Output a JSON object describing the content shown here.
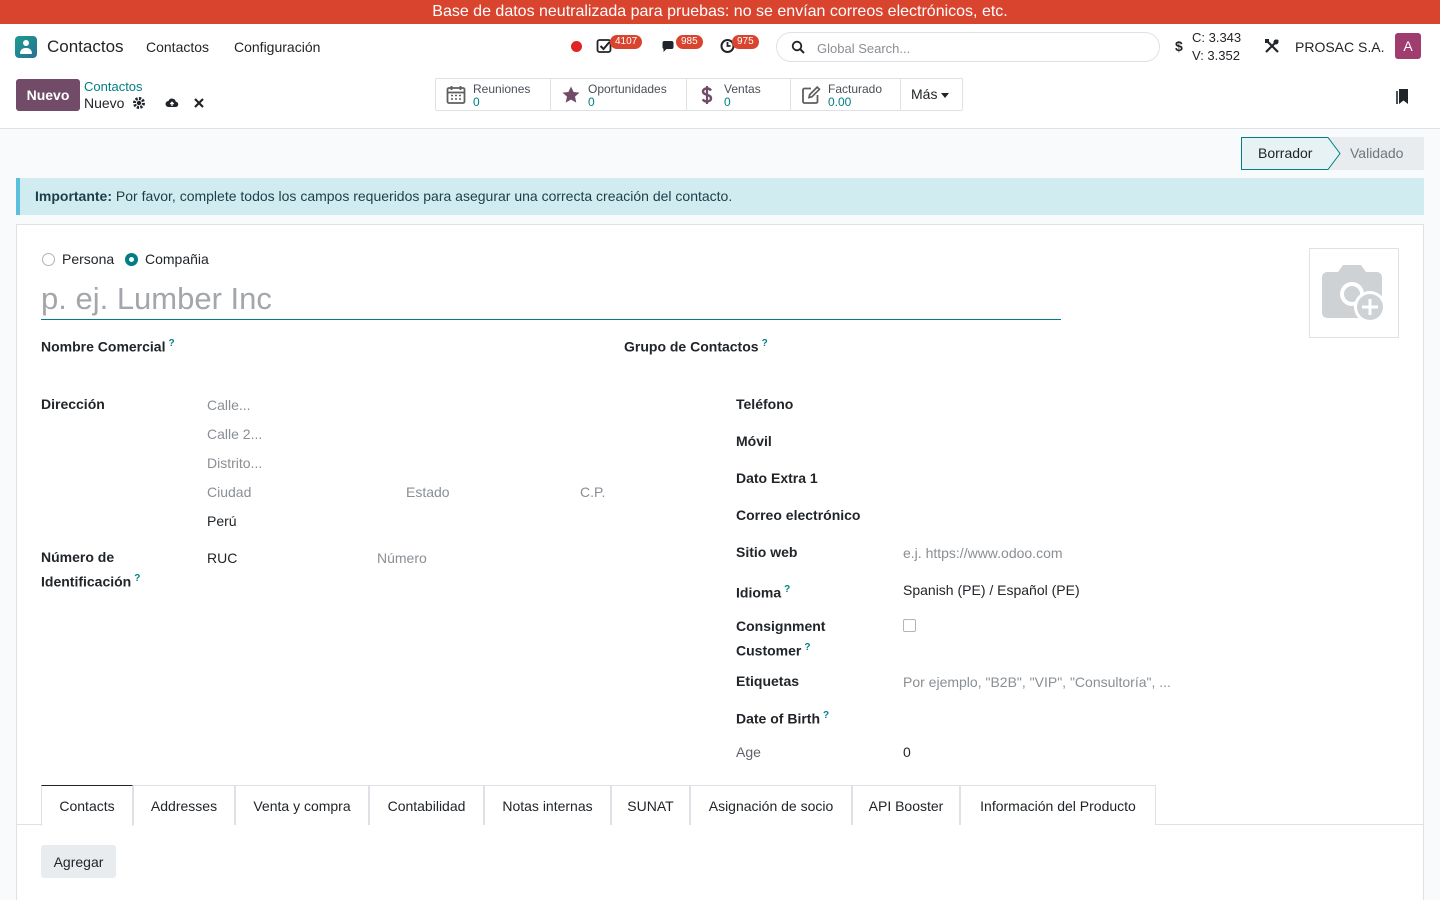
{
  "banner": {
    "text": "Base de datos neutralizada para pruebas: no se envían correos electrónicos, etc."
  },
  "navbar": {
    "app_name": "Contactos",
    "menu": [
      "Contactos",
      "Configuración"
    ],
    "badges": {
      "activities": "4107",
      "messages": "985",
      "timers": "975"
    },
    "search_placeholder": "Global Search...",
    "currency_symbol": "$",
    "rate_buy": "C: 3.343",
    "rate_sell": "V: 3.352",
    "company": "PROSAC S.A.",
    "avatar_letter": "A",
    "accent": "#714b67"
  },
  "control": {
    "new_label": "Nuevo",
    "breadcrumb_parent": "Contactos",
    "breadcrumb_current": "Nuevo",
    "smart_buttons": [
      {
        "label": "Reuniones",
        "value": "0",
        "icon": "calendar-icon"
      },
      {
        "label": "Oportunidades",
        "value": "0",
        "icon": "star-icon"
      },
      {
        "label": "Ventas",
        "value": "0",
        "icon": "dollar-icon"
      },
      {
        "label": "Facturado",
        "value": "0.00",
        "icon": "edit-icon"
      }
    ],
    "more_label": "Más"
  },
  "status": {
    "active": "Borrador",
    "next": "Validado"
  },
  "alert": {
    "bold": "Importante:",
    "text": " Por favor, complete todos los campos requeridos para asegurar una correcta creación del contacto."
  },
  "form": {
    "type_person": "Persona",
    "type_company": "Compañia",
    "name_placeholder": "p. ej. Lumber Inc",
    "trade_name_label": "Nombre Comercial",
    "contact_group_label": "Grupo de Contactos",
    "address_label": "Dirección",
    "street_placeholder": "Calle...",
    "street2_placeholder": "Calle 2...",
    "district_placeholder": "Distrito...",
    "city_placeholder": "Ciudad",
    "state_placeholder": "Estado",
    "zip_placeholder": "C.P.",
    "country": "Perú",
    "id_label_1": "Número de",
    "id_label_2": "Identificación",
    "id_type": "RUC",
    "id_number_placeholder": "Número",
    "phone_label": "Teléfono",
    "mobile_label": "Móvil",
    "extra_label": "Dato Extra 1",
    "email_label": "Correo electrónico",
    "website_label": "Sitio web",
    "website_placeholder": "e.j. https://www.odoo.com",
    "language_label": "Idioma",
    "language_value": "Spanish (PE) / Español (PE)",
    "consignment_label_1": "Consignment",
    "consignment_label_2": "Customer",
    "tags_label": "Etiquetas",
    "tags_placeholder": "Por ejemplo, \"B2B\", \"VIP\", \"Consultoría\", ...",
    "dob_label": "Date of Birth",
    "age_label": "Age",
    "age_value": "0",
    "help_mark": "?"
  },
  "tabs": [
    "Contacts",
    "Addresses",
    "Venta y compra",
    "Contabilidad",
    "Notas internas",
    "SUNAT",
    "Asignación de socio",
    "API Booster",
    "Información del Producto"
  ],
  "add_label": "Agregar"
}
